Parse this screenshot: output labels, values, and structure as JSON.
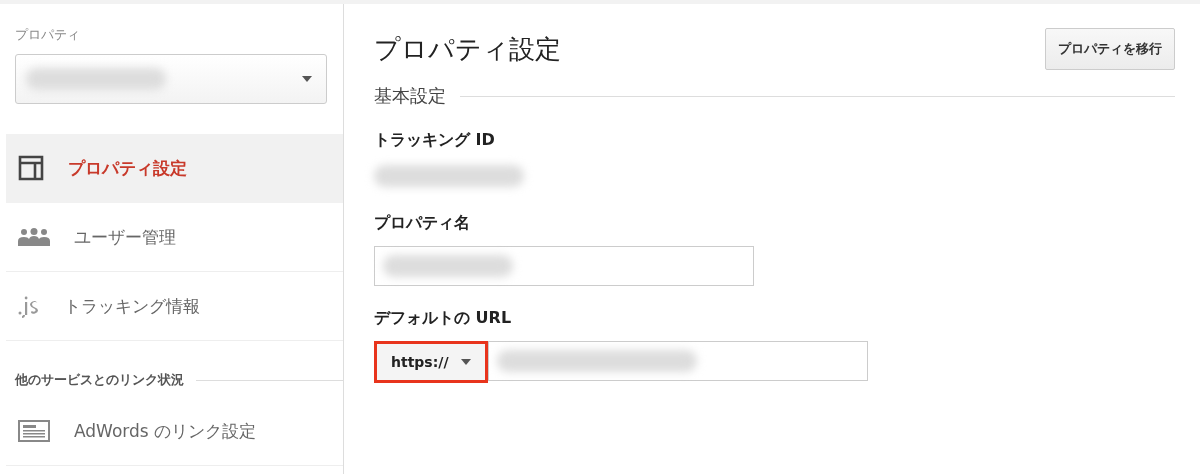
{
  "sidebar": {
    "property_label": "プロパティ",
    "items": [
      {
        "label": "プロパティ設定",
        "kind": "layout",
        "selected": true
      },
      {
        "label": "ユーザー管理",
        "kind": "users",
        "selected": false
      },
      {
        "label": "トラッキング情報",
        "kind": "js",
        "selected": false
      }
    ],
    "section": {
      "title": "他のサービスとのリンク状況",
      "items": [
        {
          "label": "AdWords のリンク設定",
          "kind": "ad",
          "selected": false
        }
      ]
    }
  },
  "main": {
    "title": "プロパティ設定",
    "move_button": "プロパティを移行",
    "section_title": "基本設定",
    "tracking_id_label": "トラッキング ID",
    "property_name_label": "プロパティ名",
    "default_url_label": "デフォルトの URL",
    "protocol": {
      "value": "https://",
      "highlighted": true
    }
  }
}
